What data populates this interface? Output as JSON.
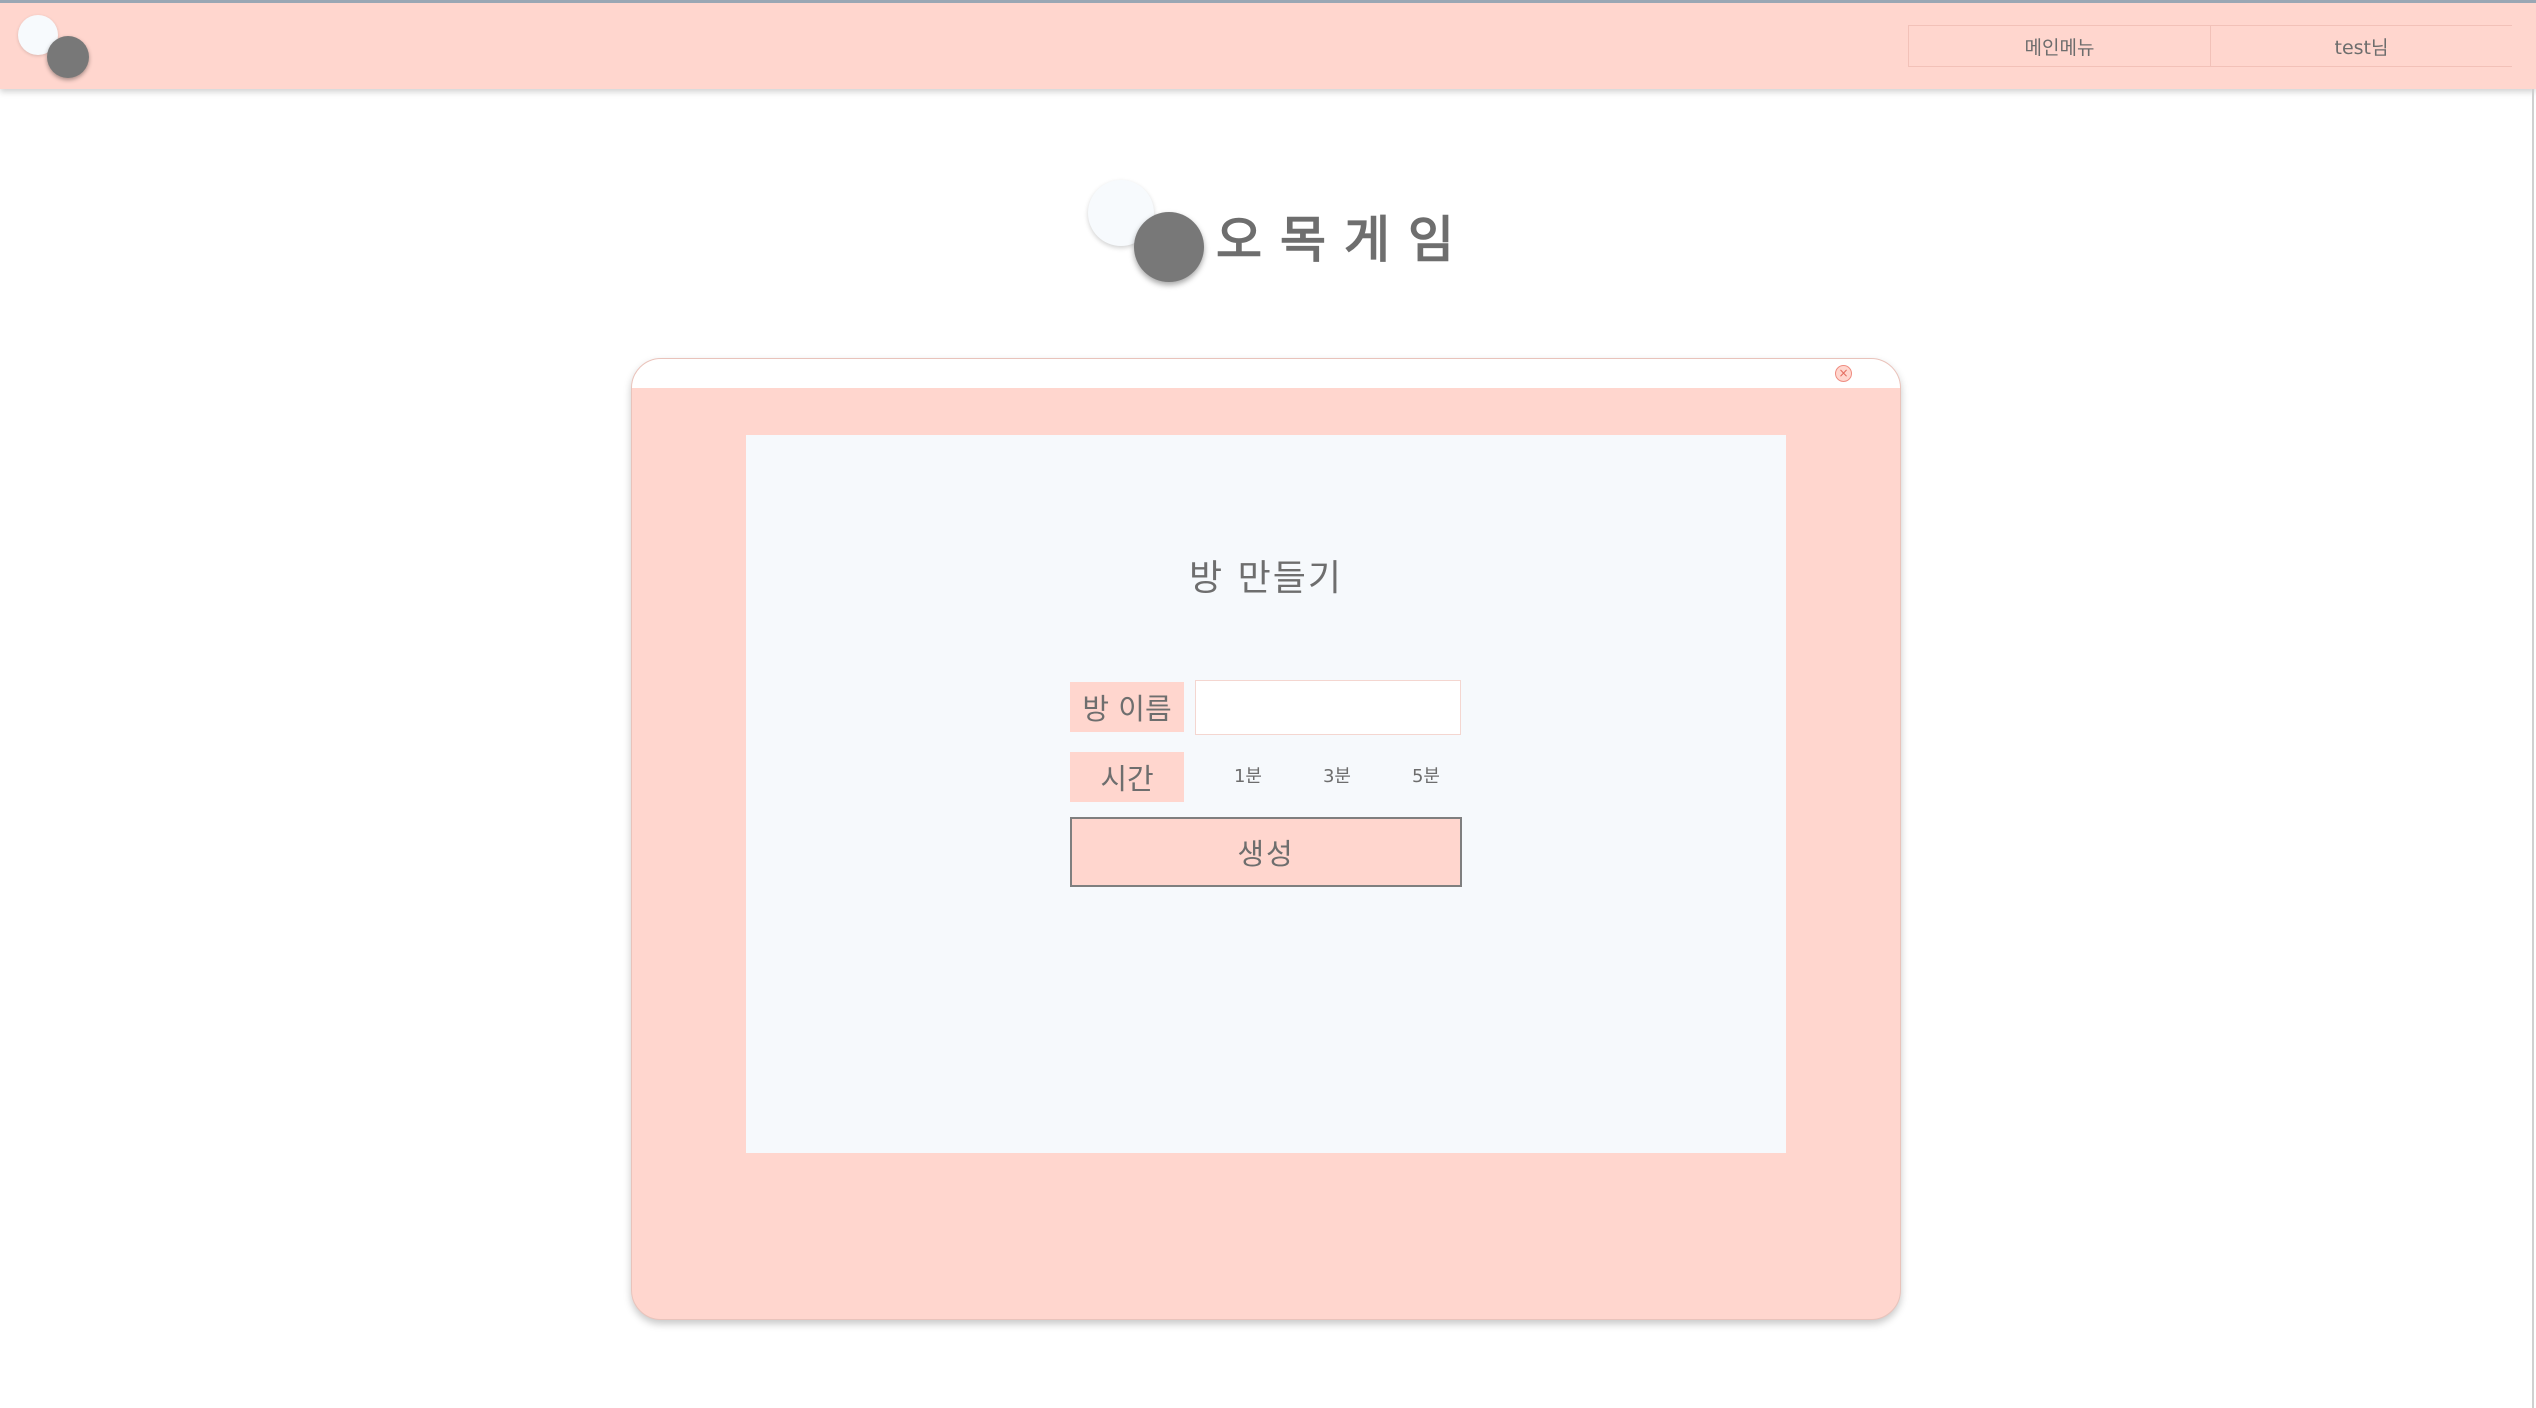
{
  "header": {
    "nav": [
      {
        "label": "메인메뉴"
      },
      {
        "label": "test님"
      }
    ]
  },
  "main": {
    "title": "오목게임"
  },
  "modal": {
    "close_icon": "×",
    "title": "방 만들기",
    "room_name_label": "방 이름",
    "room_name_value": "",
    "time_label": "시간",
    "time_options": [
      "1분",
      "3분",
      "5분"
    ],
    "create_label": "생성"
  },
  "colors": {
    "accent_pink": "#ffd6ce",
    "panel_bg": "#f6f9fc",
    "text_gray": "#6e6e6e",
    "stone_black": "#787878",
    "stone_white": "#f7fafd"
  }
}
